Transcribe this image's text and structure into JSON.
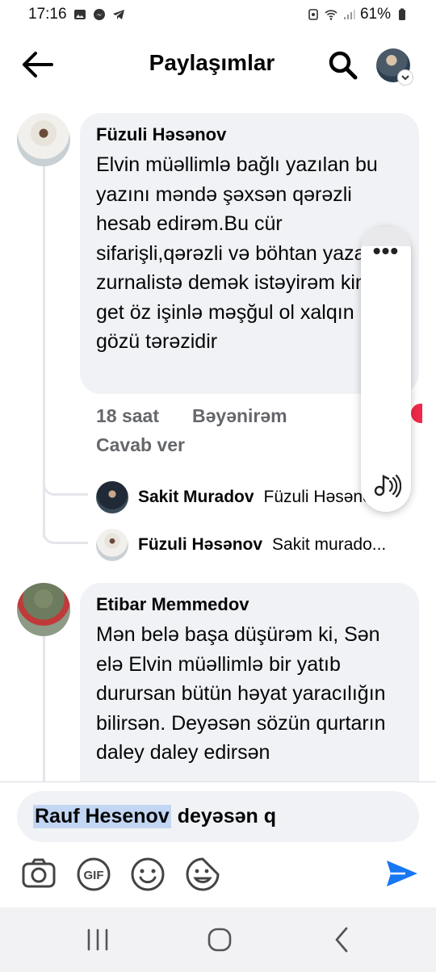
{
  "status_bar": {
    "time": "17:16",
    "battery": "61%"
  },
  "header": {
    "title": "Paylaşımlar"
  },
  "comments": [
    {
      "author": "Füzuli Həsənov",
      "text": "Elvin müəllimlə bağlı yazılan bu yazını məndə şəxsən qərəzli hesab edirəm.Bu cür sifarişli,qərəzli və böhtan yazan zurnalistə demək istəyirəm kin, get öz işinlə məşğul ol xalqın gözü tərəzidir",
      "time": "18 saat",
      "like_label": "Bəyənirəm",
      "reply_label": "Cavab ver",
      "replies": [
        {
          "author": "Sakit Muradov",
          "preview": "Füzuli Həsənov ..."
        },
        {
          "author": "Füzuli Həsənov",
          "preview": "Sakit murado..."
        }
      ]
    },
    {
      "author": "Etibar Memmedov",
      "text": "Mən belə başa düşürəm ki, Sən elə Elvin müəllimlə bir yatıb durursan bütün həyat yaracılığın bilirsən. Deyəsən sözün qurtarın daley daley edirsən"
    }
  ],
  "composer": {
    "mention": "Rauf Hesenov",
    "text": "deyəsən q"
  },
  "icons": {
    "back": "back-arrow-icon",
    "search": "search-icon",
    "camera": "camera-icon",
    "gif": "gif-icon",
    "emoji": "emoji-icon",
    "sticker": "sticker-icon",
    "send": "send-icon"
  },
  "colors": {
    "accent": "#1877f2",
    "bubble": "#f0f2f5",
    "meta": "#65676b"
  }
}
